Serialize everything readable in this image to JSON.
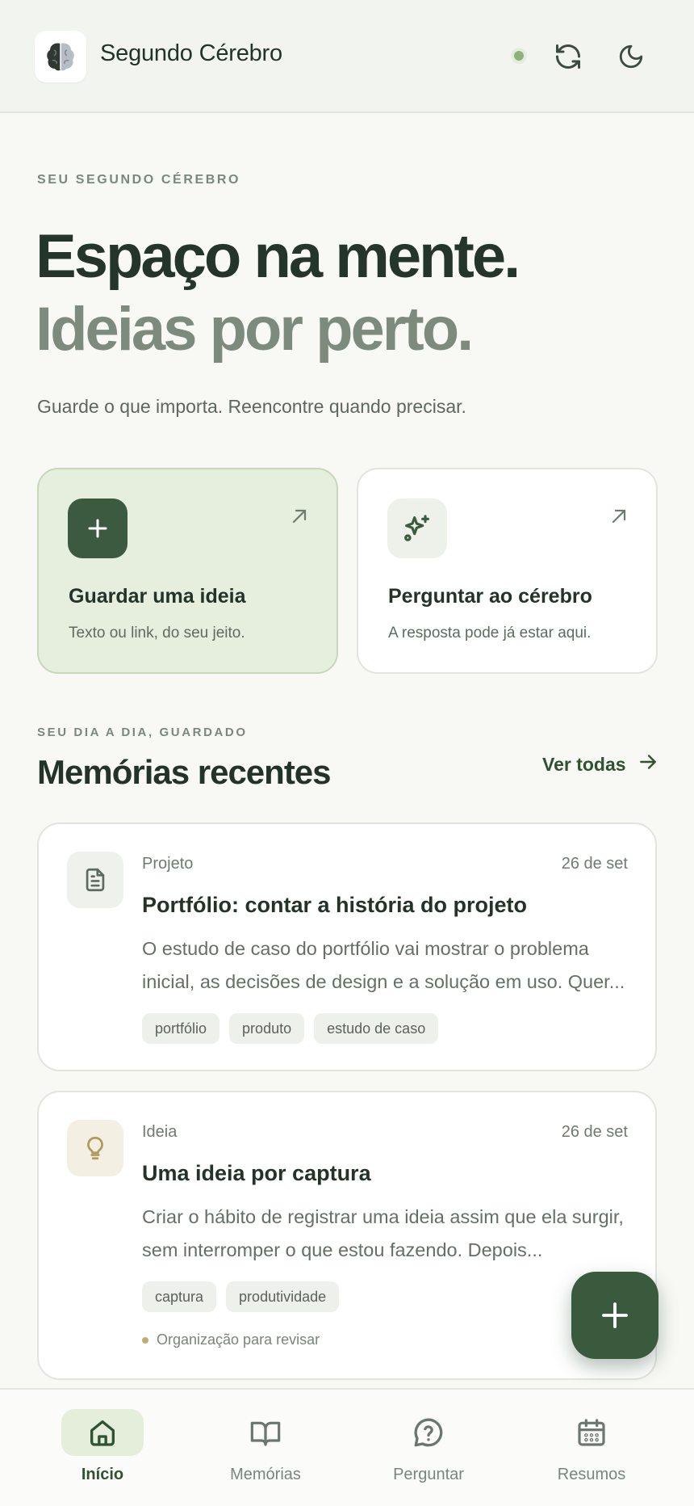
{
  "header": {
    "app_title": "Segundo Cérebro",
    "logo_icon": "brain-icon",
    "sync_icon": "refresh-icon",
    "theme_icon": "moon-icon",
    "status_color": "#8db27a"
  },
  "hero": {
    "eyebrow": "SEU SEGUNDO CÉREBRO",
    "line1": "Espaço na mente.",
    "line2": "Ideias por perto.",
    "subtitle": "Guarde o que importa. Reencontre quando precisar."
  },
  "actions": [
    {
      "title": "Guardar uma ideia",
      "description": "Texto ou link, do seu jeito.",
      "icon": "plus-icon"
    },
    {
      "title": "Perguntar ao cérebro",
      "description": "A resposta pode já estar aqui.",
      "icon": "sparkles-icon"
    }
  ],
  "recent": {
    "eyebrow": "SEU DIA A DIA, GUARDADO",
    "title": "Memórias recentes",
    "see_all": "Ver todas"
  },
  "memories": [
    {
      "kind": "Projeto",
      "date": "26 de set",
      "title": "Portfólio: contar a história do projeto",
      "body": "O estudo de caso do portfólio vai mostrar o problema inicial, as decisões de design e a solução em uso. Quer...",
      "tags": [
        "portfólio",
        "produto",
        "estudo de caso"
      ],
      "icon": "document-icon"
    },
    {
      "kind": "Ideia",
      "date": "26 de set",
      "title": "Uma ideia por captura",
      "body": "Criar o hábito de registrar uma ideia assim que ela surgir, sem interromper o que estou fazendo. Depois...",
      "tags": [
        "captura",
        "produtividade"
      ],
      "note": "Organização para revisar",
      "icon": "lightbulb-icon"
    }
  ],
  "nav": [
    {
      "label": "Início",
      "icon": "home-icon",
      "active": true
    },
    {
      "label": "Memórias",
      "icon": "book-icon",
      "active": false
    },
    {
      "label": "Perguntar",
      "icon": "question-icon",
      "active": false
    },
    {
      "label": "Resumos",
      "icon": "calendar-icon",
      "active": false
    }
  ],
  "colors": {
    "accent": "#3a5a3e",
    "accent_soft": "#e6eedd",
    "background": "#f8f8f5"
  }
}
